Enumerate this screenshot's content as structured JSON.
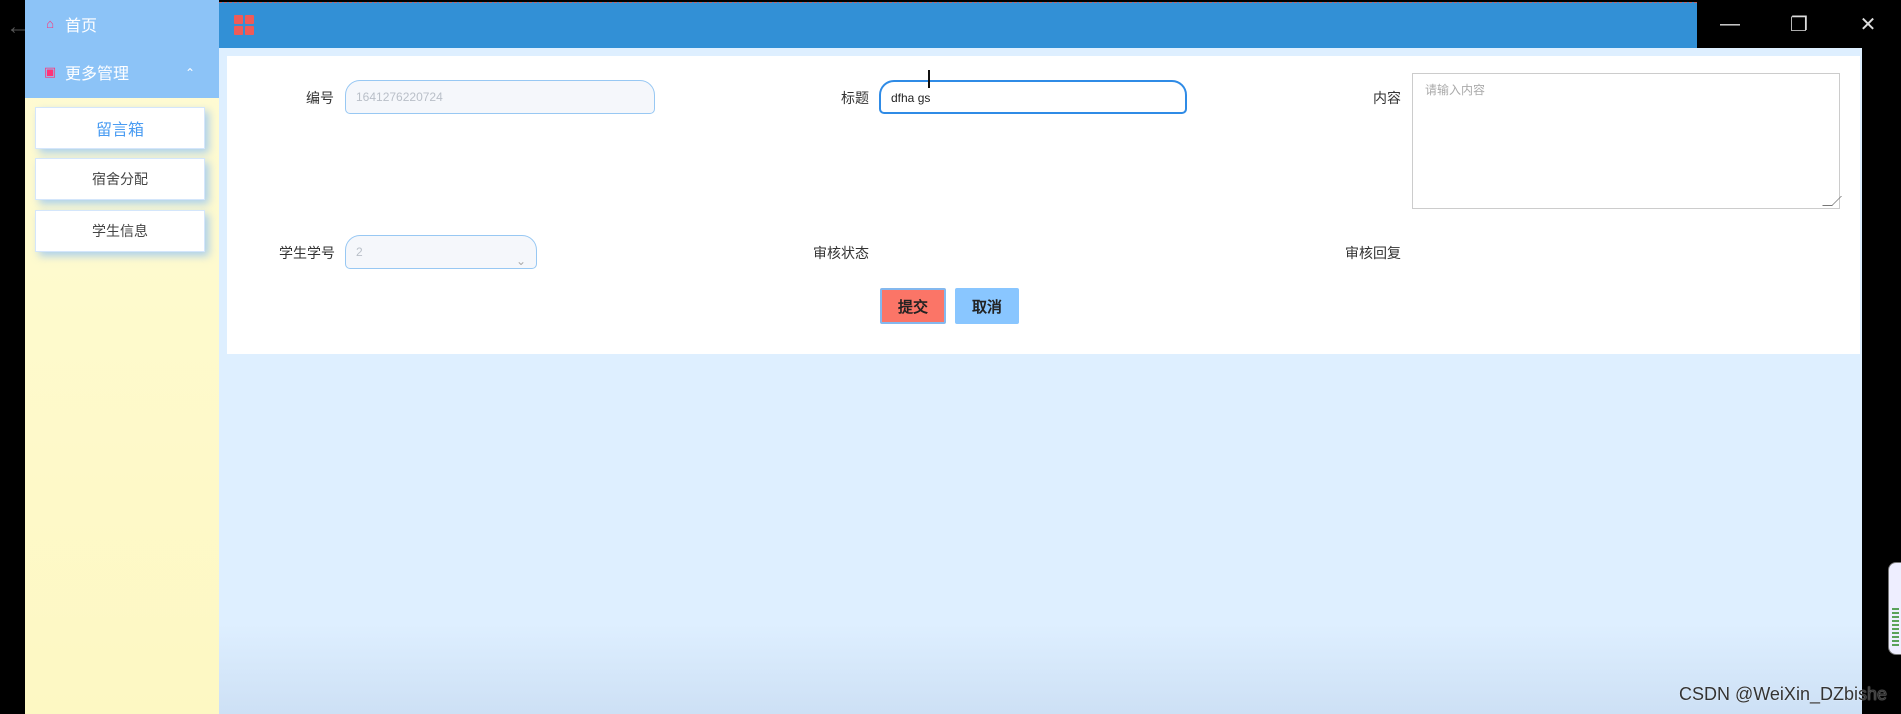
{
  "sidebar": {
    "home": "首页",
    "more": "更多管理",
    "items": [
      {
        "label": "留言箱"
      },
      {
        "label": "宿舍分配"
      },
      {
        "label": "学生信息"
      }
    ]
  },
  "form": {
    "id_label": "编号",
    "id_value": "1641276220724",
    "title_label": "标题",
    "title_value": "dfha gs",
    "content_label": "内容",
    "content_placeholder": "请输入内容",
    "student_label": "学生学号",
    "student_value": "2",
    "review_status_label": "审核状态",
    "review_reply_label": "审核回复",
    "submit": "提交",
    "cancel": "取消"
  },
  "watermark": "CSDN @WeiXin_DZbishe",
  "colors": {
    "sidebar_header": "#8cc3f7",
    "topbar": "#3290d6",
    "submit": "#fb7567",
    "cancel": "#89c6ff"
  },
  "icons": {
    "back": "back-arrow-icon",
    "home": "home-icon",
    "more": "folder-icon",
    "grid": "grid-icon",
    "minimize": "minimize-icon",
    "restore": "restore-icon",
    "close": "close-icon"
  }
}
